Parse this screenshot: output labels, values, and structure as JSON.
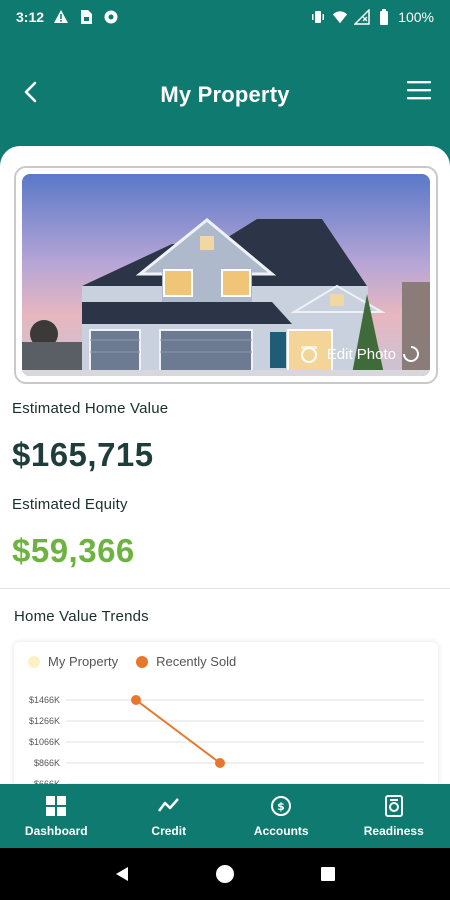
{
  "status": {
    "time": "3:12",
    "battery": "100%",
    "icons_left": [
      "warning-icon",
      "sim-icon",
      "settings-icon"
    ],
    "icons_right": [
      "vibrate-icon",
      "wifi-icon",
      "signal-icon",
      "battery-icon"
    ]
  },
  "header": {
    "title": "My Property"
  },
  "property": {
    "edit_photo_label": "Edit Photo",
    "home_value_label": "Estimated Home Value",
    "home_value": "$165,715",
    "equity_label": "Estimated Equity",
    "equity_value": "$59,366"
  },
  "trends": {
    "title": "Home Value Trends",
    "legend": [
      {
        "name": "My Property",
        "color": "#fbf1c4"
      },
      {
        "name": "Recently Sold",
        "color": "#e8772e"
      }
    ]
  },
  "chart_data": {
    "type": "line",
    "yticks": [
      "$1466K",
      "$1266K",
      "$1066K",
      "$866K",
      "$666K"
    ],
    "ylim": [
      666,
      1466
    ],
    "series": [
      {
        "name": "Recently Sold",
        "color": "#e8772e",
        "points": [
          {
            "x": 1,
            "y": 1466
          },
          {
            "x": 2,
            "y": 866
          }
        ]
      }
    ],
    "grid": true
  },
  "nav": {
    "items": [
      {
        "label": "Dashboard",
        "icon": "dashboard-icon"
      },
      {
        "label": "Credit",
        "icon": "trend-icon"
      },
      {
        "label": "Accounts",
        "icon": "accounts-icon"
      },
      {
        "label": "Readiness",
        "icon": "readiness-icon"
      }
    ]
  },
  "colors": {
    "brand": "#0f7b70",
    "equity": "#6db33f",
    "home_value": "#1f3d3a",
    "recently_sold": "#e8772e"
  }
}
